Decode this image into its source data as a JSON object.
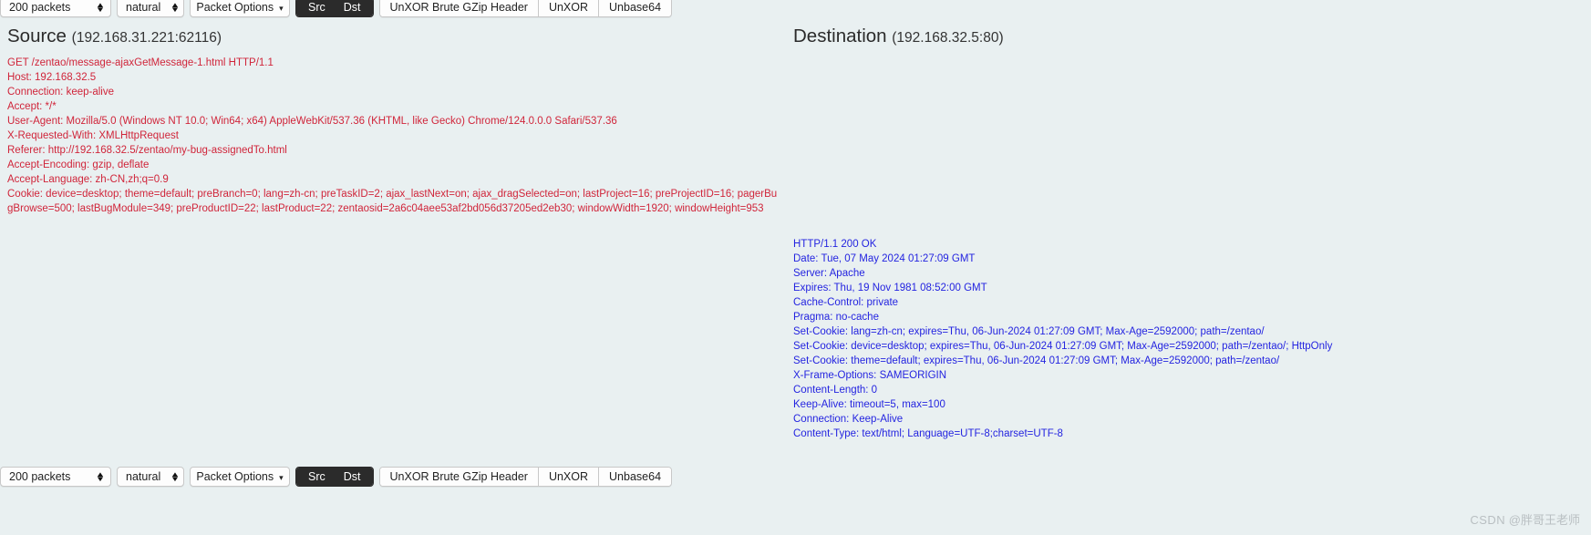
{
  "toolbar": {
    "packets_select": {
      "value": "200 packets",
      "options": [
        "200 packets"
      ]
    },
    "view_select": {
      "value": "natural",
      "options": [
        "natural"
      ]
    },
    "packet_options_button": "Packet Options",
    "caret_glyph": "▾",
    "src_button": "Src",
    "dst_button": "Dst",
    "buttons": [
      "UnXOR Brute GZip Header",
      "UnXOR",
      "Unbase64"
    ]
  },
  "source": {
    "title": "Source",
    "address": "(192.168.31.221:62116)",
    "text": "GET /zentao/message-ajaxGetMessage-1.html HTTP/1.1\nHost: 192.168.32.5\nConnection: keep-alive\nAccept: */*\nUser-Agent: Mozilla/5.0 (Windows NT 10.0; Win64; x64) AppleWebKit/537.36 (KHTML, like Gecko) Chrome/124.0.0.0 Safari/537.36\nX-Requested-With: XMLHttpRequest\nReferer: http://192.168.32.5/zentao/my-bug-assignedTo.html\nAccept-Encoding: gzip, deflate\nAccept-Language: zh-CN,zh;q=0.9\nCookie: device=desktop; theme=default; preBranch=0; lang=zh-cn; preTaskID=2; ajax_lastNext=on; ajax_dragSelected=on; lastProject=16; preProjectID=16; pagerBugBrowse=500; lastBugModule=349; preProductID=22; lastProduct=22; zentaosid=2a6c04aee53af2bd056d37205ed2eb30; windowWidth=1920; windowHeight=953"
  },
  "destination": {
    "title": "Destination",
    "address": "(192.168.32.5:80)",
    "text": "HTTP/1.1 200 OK\nDate: Tue, 07 May 2024 01:27:09 GMT\nServer: Apache\nExpires: Thu, 19 Nov 1981 08:52:00 GMT\nCache-Control: private\nPragma: no-cache\nSet-Cookie: lang=zh-cn; expires=Thu, 06-Jun-2024 01:27:09 GMT; Max-Age=2592000; path=/zentao/\nSet-Cookie: device=desktop; expires=Thu, 06-Jun-2024 01:27:09 GMT; Max-Age=2592000; path=/zentao/; HttpOnly\nSet-Cookie: theme=default; expires=Thu, 06-Jun-2024 01:27:09 GMT; Max-Age=2592000; path=/zentao/\nX-Frame-Options: SAMEORIGIN\nContent-Length: 0\nKeep-Alive: timeout=5, max=100\nConnection: Keep-Alive\nContent-Type: text/html; Language=UTF-8;charset=UTF-8"
  },
  "watermark": {
    "brand": "CSDN",
    "author": "@胖哥王老师"
  },
  "colors": {
    "background": "#e9f0f1",
    "request_text": "#d0253a",
    "response_text": "#2424e0",
    "segment_active_bg": "#2b2b2b"
  }
}
